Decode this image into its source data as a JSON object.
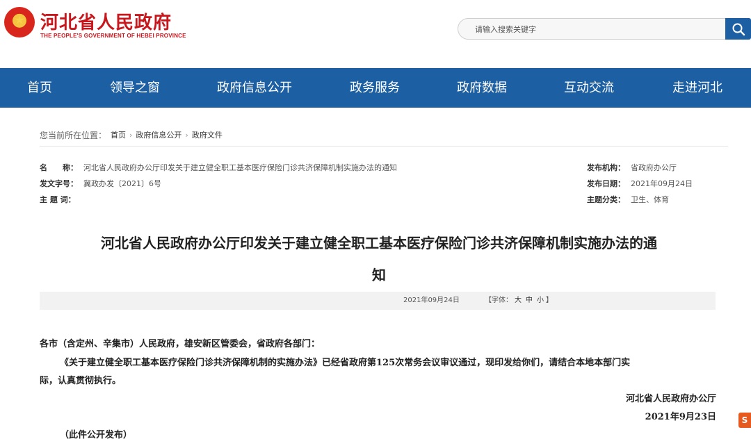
{
  "header": {
    "site_title": "河北省人民政府",
    "site_subtitle": "THE PEOPLE'S GOVERNMENT OF HEBEI PROVINCE",
    "search_placeholder": "请输入搜索关键字"
  },
  "nav": [
    {
      "label": "首页"
    },
    {
      "label": "领导之窗"
    },
    {
      "label": "政府信息公开"
    },
    {
      "label": "政务服务"
    },
    {
      "label": "政府数据"
    },
    {
      "label": "互动交流"
    },
    {
      "label": "走进河北"
    }
  ],
  "breadcrumb": {
    "prefix": "您当前所在位置：",
    "items": [
      "首页",
      "政府信息公开",
      "政府文件"
    ]
  },
  "meta": {
    "name_label": "名　　称：",
    "name_value": "河北省人民政府办公厅印发关于建立健全职工基本医疗保险门诊共济保障机制实施办法的通知",
    "doc_no_label": "发文字号：",
    "doc_no_value": "冀政办发〔2021〕6号",
    "subject_label": "主 题 词：",
    "subject_value": "",
    "org_label": "发布机构：",
    "org_value": "省政府办公厅",
    "date_label": "发布日期：",
    "date_value": "2021年09月24日",
    "category_label": "主题分类：",
    "category_value": "卫生、体育"
  },
  "article": {
    "title_line1": "河北省人民政府办公厅印发关于建立健全职工基本医疗保险门诊共济保障机制实施办法的通",
    "title_line2": "知",
    "info_date": "2021年09月24日",
    "font_label": "【字体：",
    "font_large": "大",
    "font_medium": "中",
    "font_small": "小",
    "font_end": "】",
    "salutation": "各市（含定州、辛集市）人民政府，雄安新区管委会，省政府各部门：",
    "para1_line1": "《关于建立健全职工基本医疗保险门诊共济保障机制的实施办法》已经省政府第125次常务会议审议通过，现印发给你们，请结合本地本部门实",
    "para1_line2": "际，认真贯彻执行。",
    "signature": "河北省人民政府办公厅",
    "sign_date": "2021年9月23日",
    "note": "（此件公开发布）"
  },
  "float_tag": "S"
}
